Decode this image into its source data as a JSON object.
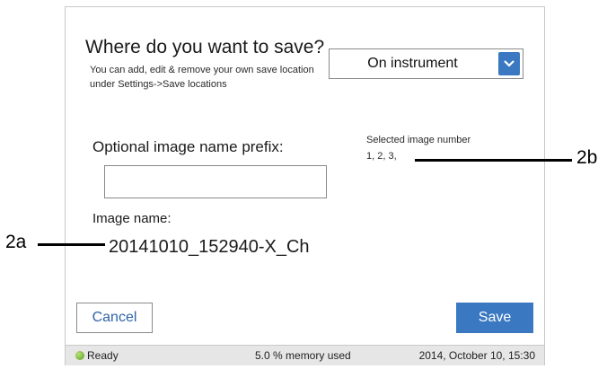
{
  "dialog": {
    "question": "Where do you want to save?",
    "hint": "You can add, edit & remove your own save location under Settings->Save locations",
    "location_select": {
      "value": "On instrument",
      "arrow_icon": "chevron-down-icon"
    },
    "prefix_label": "Optional image name prefix:",
    "prefix_input_value": "",
    "selected_image_label": "Selected image number",
    "selected_image_value": "1, 2, 3,",
    "image_name_label": "Image name:",
    "image_name_value": "20141010_152940-X_Ch",
    "cancel_label": "Cancel",
    "save_label": "Save"
  },
  "status_bar": {
    "ready": "Ready",
    "memory": "5.0 % memory used",
    "datetime": "2014, October 10, 15:30",
    "ready_color": "#6aad2a"
  },
  "callouts": {
    "a": "2a",
    "b": "2b"
  },
  "colors": {
    "accent": "#3a78c2",
    "cancel_text": "#2e63a8"
  }
}
